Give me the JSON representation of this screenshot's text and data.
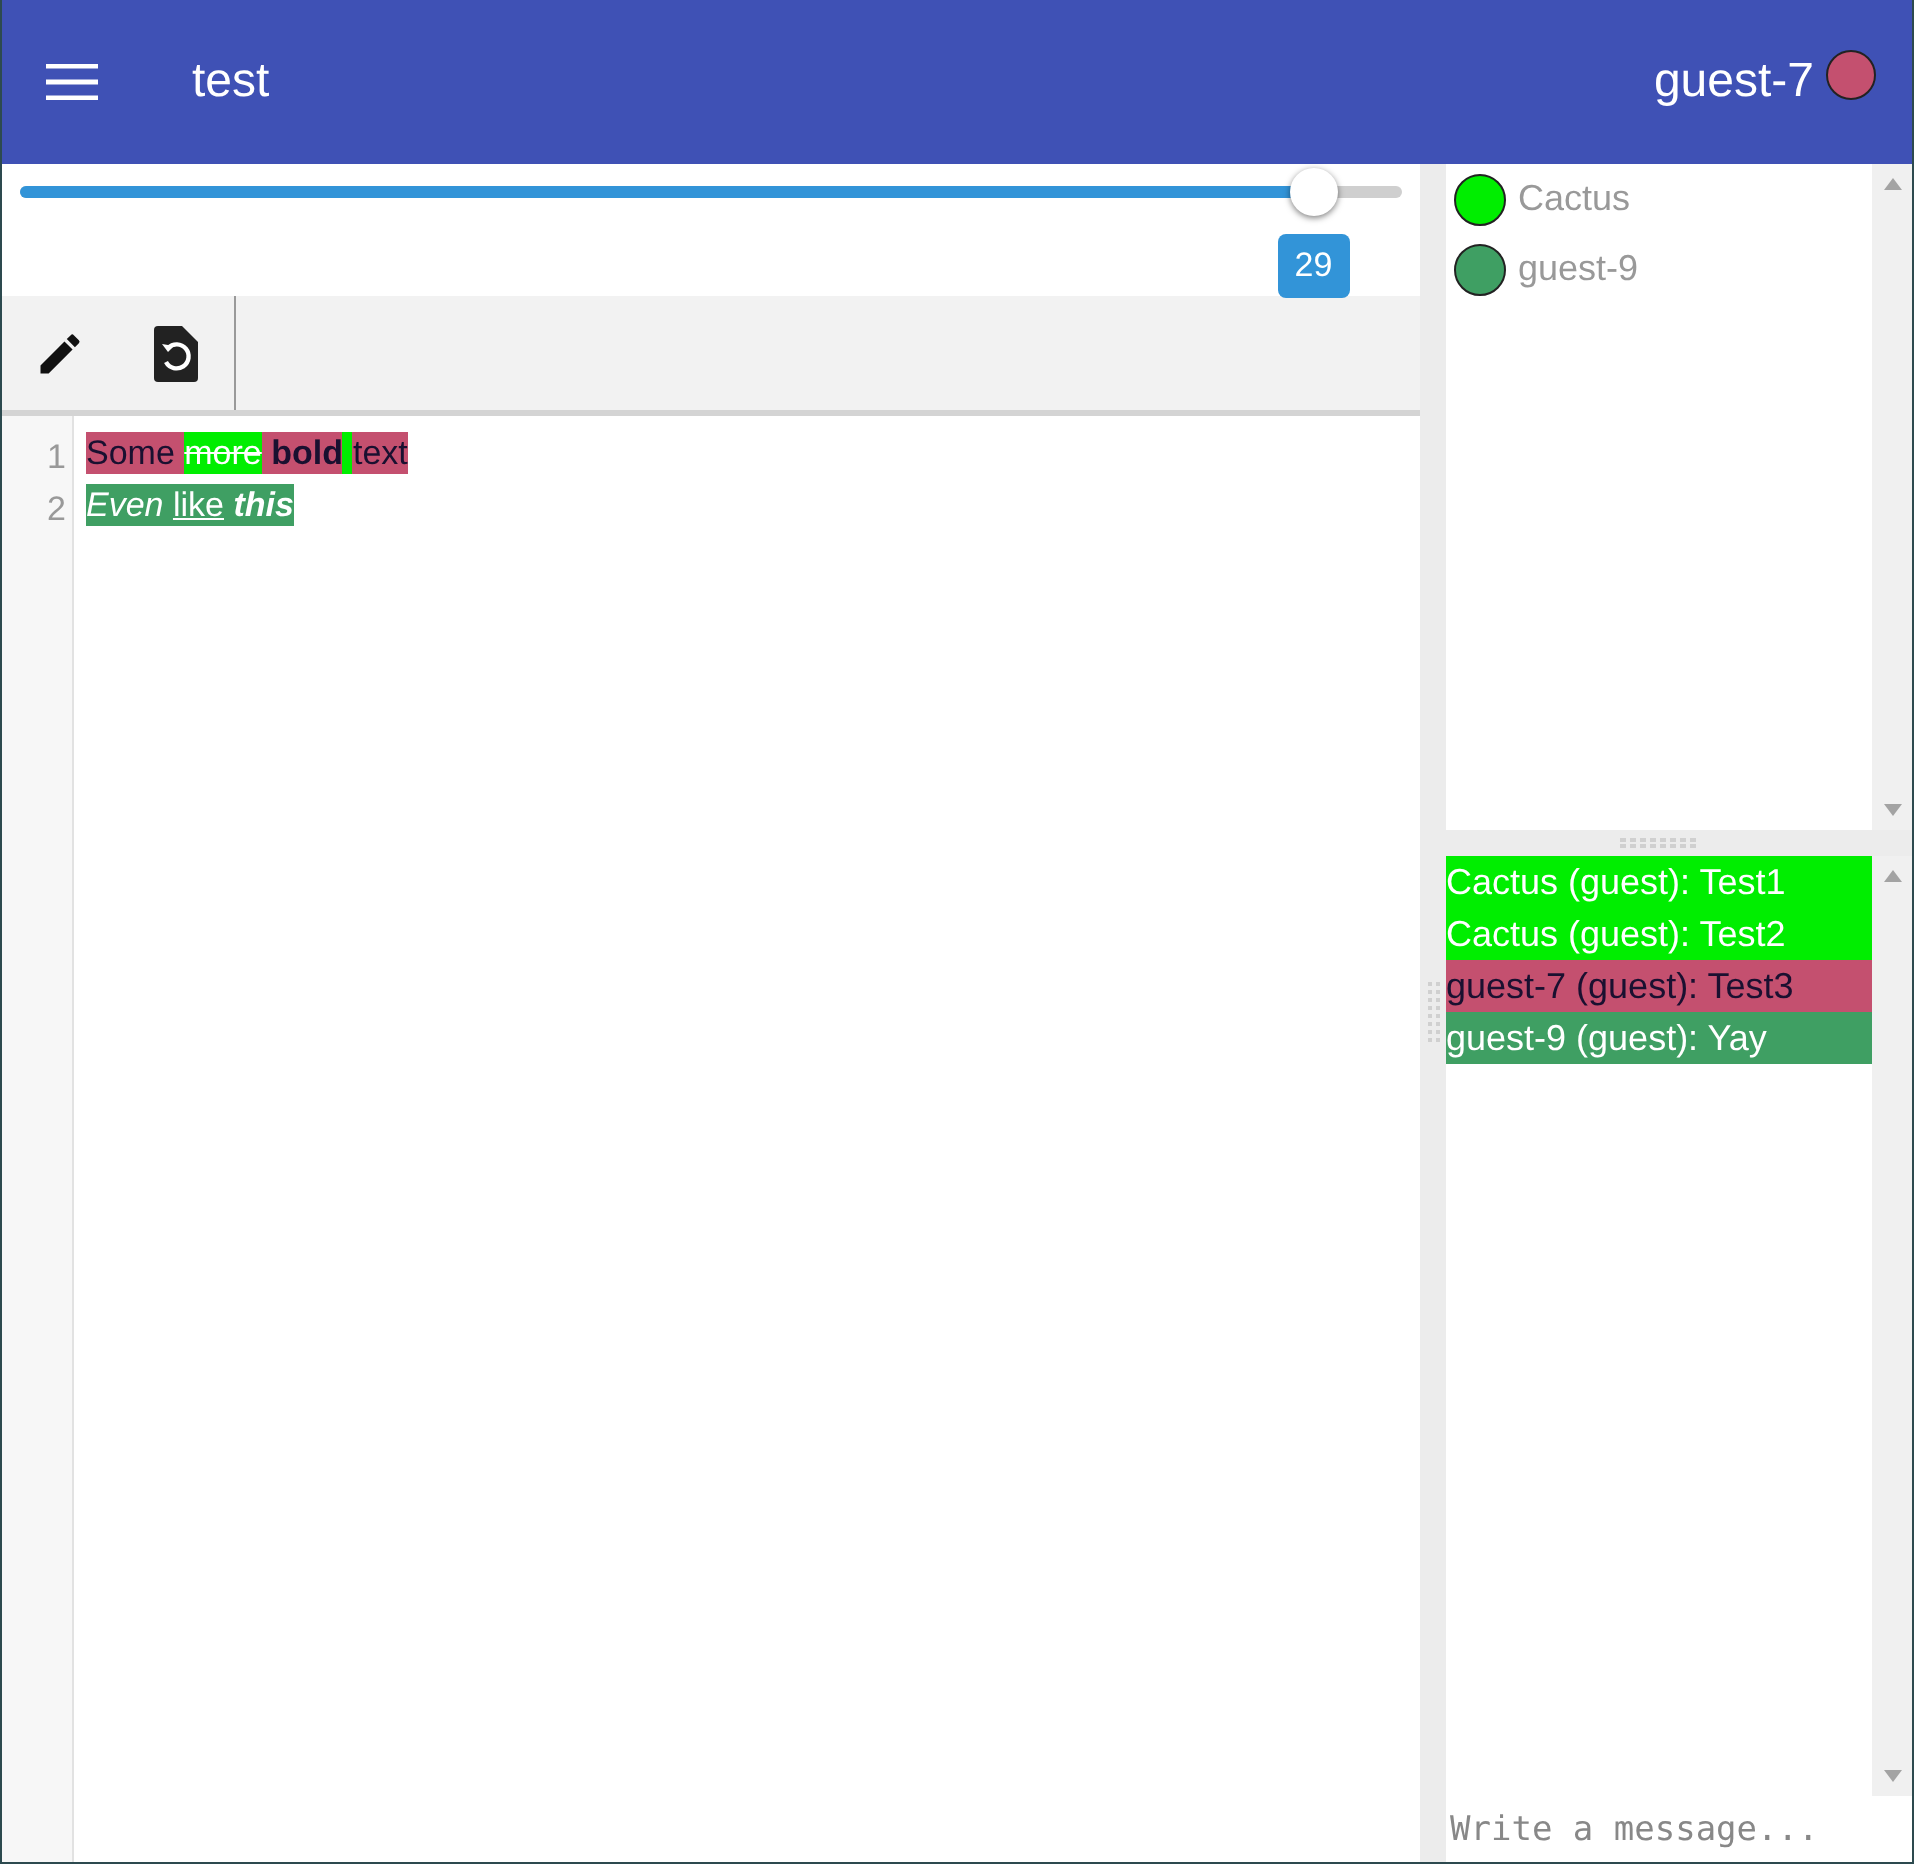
{
  "app_bar": {
    "title": "test",
    "user": {
      "name": "guest-7",
      "color": "#c4506f"
    }
  },
  "slider": {
    "level": 0.936,
    "reading": "29"
  },
  "editor": {
    "lines": [
      {
        "number": "1",
        "segments": [
          {
            "text": "Some ",
            "color": "#c4506f",
            "dark_text": true
          },
          {
            "text": "more",
            "color": "#00ee00",
            "dark_text": false,
            "strikethrough": true
          },
          {
            "text": " bold",
            "color": "#c4506f",
            "dark_text": true,
            "bold": true
          },
          {
            "color": "#00ee00"
          },
          {
            "text": "text",
            "color": "#c4506f",
            "dark_text": true
          }
        ]
      },
      {
        "number": "2",
        "segments": [
          {
            "text": "Even ",
            "color": "#3f9f63",
            "dark_text": false,
            "italic": true
          },
          {
            "text": "like",
            "color": "#3f9f63",
            "dark_text": false,
            "underline": true
          },
          {
            "text": " this",
            "color": "#3f9f63",
            "dark_text": false,
            "bold": true,
            "italic": true
          }
        ]
      }
    ]
  },
  "users": [
    {
      "name": "Cactus",
      "color": "#00ee00"
    },
    {
      "name": "guest-9",
      "color": "#3f9f63"
    }
  ],
  "chat": {
    "messages": [
      {
        "text": "Cactus (guest): Test1",
        "color": "#00ee00",
        "dark_text": false
      },
      {
        "text": "Cactus (guest): Test2",
        "color": "#00ee00",
        "dark_text": false
      },
      {
        "text": "guest-7 (guest): Test3",
        "color": "#c4506f",
        "dark_text": true
      },
      {
        "text": "guest-9 (guest): Yay",
        "color": "#3f9f63",
        "dark_text": false
      }
    ],
    "placeholder": "Write a message..."
  }
}
